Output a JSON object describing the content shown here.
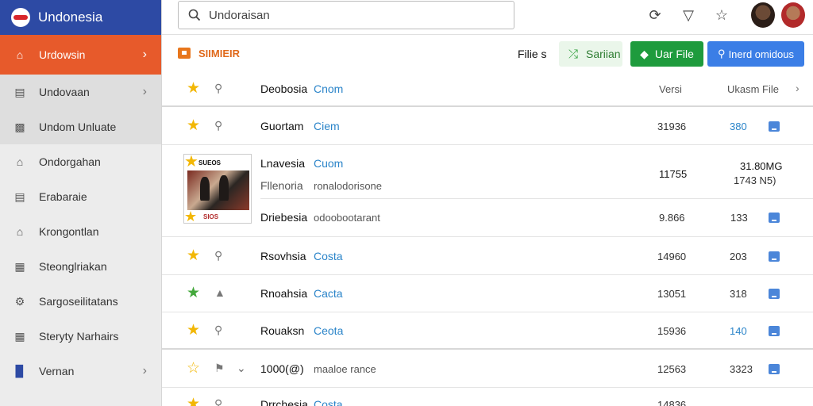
{
  "brand": {
    "title": "Undonesia"
  },
  "sidebar": {
    "items": [
      {
        "label": "Urdowsin",
        "icon": "home-icon",
        "active": true,
        "chevron": true
      },
      {
        "label": "Undovaan",
        "icon": "list-icon",
        "chevron": true
      },
      {
        "label": "Undom Unluate",
        "icon": "folder-icon"
      },
      {
        "label": "Ondorgahan",
        "icon": "building-icon"
      },
      {
        "label": "Erabaraie",
        "icon": "list-icon"
      },
      {
        "label": "Krongontlan",
        "icon": "home-icon"
      },
      {
        "label": "Steonglriakan",
        "icon": "document-icon"
      },
      {
        "label": "Sargoseilitatans",
        "icon": "gear-icon"
      },
      {
        "label": "Steryty Narhairs",
        "icon": "document-icon"
      },
      {
        "label": "Vernan",
        "icon": "bar-chart-icon",
        "chevron": true
      }
    ]
  },
  "search": {
    "value": "Undoraisan"
  },
  "toolbar": {
    "title": "SIIMIEIR",
    "files_label": "Filie s",
    "saran_label": "Sariian",
    "green_button": "Uar File",
    "blue_button": "Inerd omidous"
  },
  "table": {
    "header": {
      "name": "Deobosia",
      "kind": "Cnom",
      "version": "Versi",
      "usage": "Ukasm File"
    },
    "rows": [
      {
        "star": "gold",
        "pin": "person-pin-icon",
        "name": "Guortam",
        "kind": "Ciem",
        "a": "31936",
        "b": "380",
        "b_blue": true
      },
      {
        "star": "gold",
        "pin": "person-pin-icon",
        "name": "Rsovhsia",
        "kind": "Costa",
        "a": "14960",
        "b": "203"
      },
      {
        "star": "green",
        "pin": "document-pin-icon",
        "name": "Rnoahsia",
        "kind": "Cacta",
        "a": "13051",
        "b": "318"
      },
      {
        "star": "gold",
        "pin": "person-pin-icon",
        "name": "Rouaksn",
        "kind": "Ceota",
        "a": "15936",
        "b": "140",
        "b_blue": true
      },
      {
        "star": "gold",
        "pin": "flag-pin-icon",
        "name": "1000(@)",
        "kind": "maaloe rance",
        "a": "12563",
        "b": "3323"
      },
      {
        "star": "gold",
        "pin": "person-pin-icon",
        "name": "Drrchesia",
        "kind": "Costa",
        "a": "14836",
        "b": ""
      }
    ],
    "expanded": {
      "line1_name": "Lnavesia",
      "line1_kind": "Cuom",
      "line2_name": "Fllenoria",
      "line2_desc": "ronalodorisone",
      "line2_num": "11755",
      "line2_right_top": "31.80MG",
      "line2_right_bottom": "1743 N5)",
      "line3_name": "Driebesia",
      "line3_desc": "odoobootarant",
      "line3_a": "9.866",
      "line3_b": "133",
      "thumb_label_top": "SUEOS",
      "thumb_label_bottom": "SIOS"
    }
  }
}
